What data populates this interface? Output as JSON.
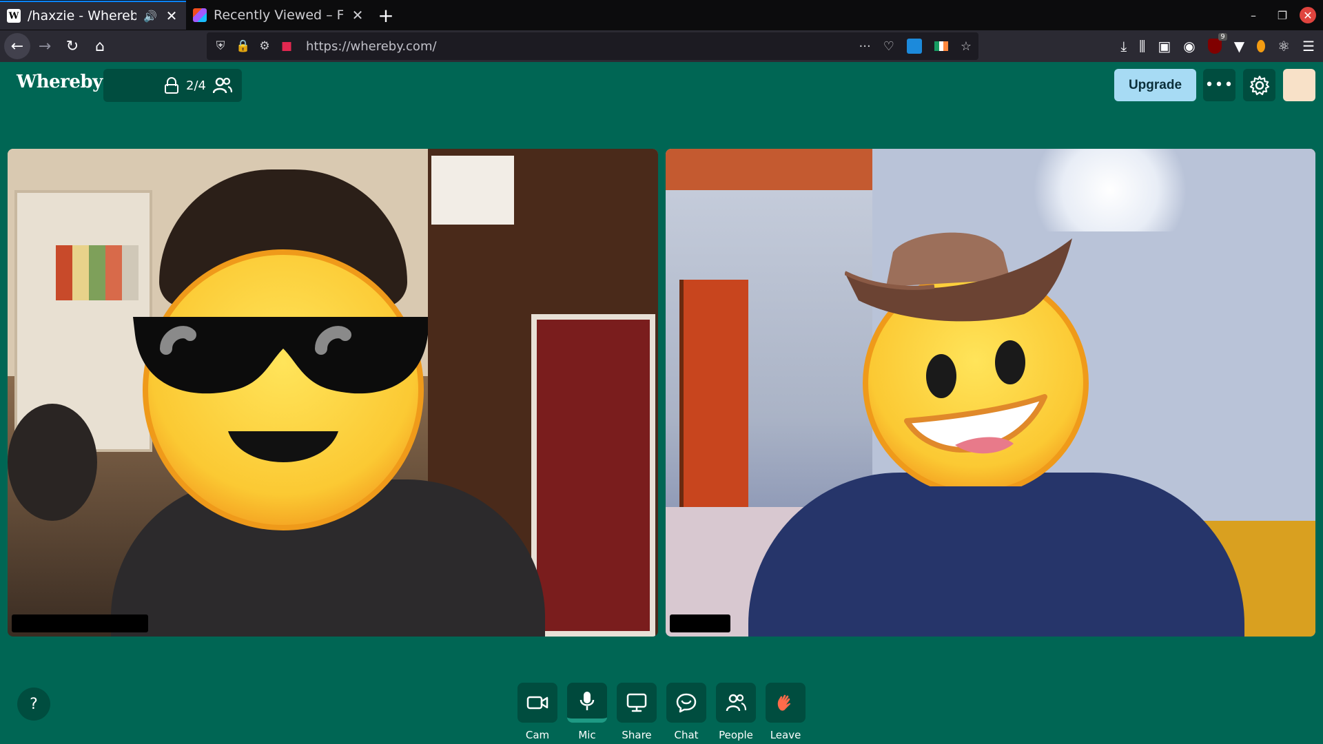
{
  "browser": {
    "tabs": [
      {
        "title": "/haxzie - Whereby",
        "favicon": "W",
        "active": true
      },
      {
        "title": "Recently Viewed – Figma",
        "favicon": "figma-icon",
        "active": false
      }
    ],
    "url": "https://whereby.com/"
  },
  "app": {
    "logo": "Whereby",
    "room": {
      "participants": "2/4"
    },
    "upgrade_label": "Upgrade",
    "help_label": "?"
  },
  "controls": [
    {
      "label": "Cam",
      "icon": "camera-icon"
    },
    {
      "label": "Mic",
      "icon": "microphone-icon"
    },
    {
      "label": "Share",
      "icon": "screen-share-icon"
    },
    {
      "label": "Chat",
      "icon": "chat-icon"
    },
    {
      "label": "People",
      "icon": "people-icon"
    },
    {
      "label": "Leave",
      "icon": "waving-hand-icon"
    }
  ],
  "colors": {
    "brand_green": "#006654",
    "dark_green": "#004d3f",
    "upgrade_blue": "#a7dbf4",
    "leave_orange": "#ff6b4a"
  }
}
